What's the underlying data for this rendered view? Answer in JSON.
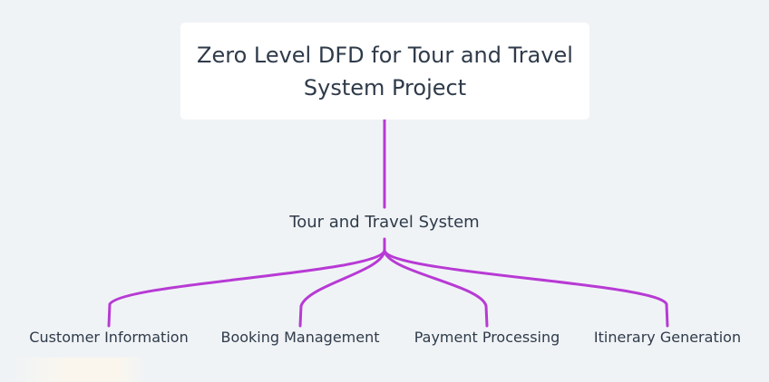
{
  "diagram": {
    "title": "Zero Level DFD for Tour and Travel System Project",
    "center_node": "Tour and Travel System",
    "leaves": [
      "Customer Information",
      "Booking Management",
      "Payment Processing",
      "Itinerary Generation"
    ],
    "colors": {
      "background": "#f0f3f6",
      "card": "#ffffff",
      "edge": "#b73ad4",
      "text": "#2f3b4a"
    }
  }
}
